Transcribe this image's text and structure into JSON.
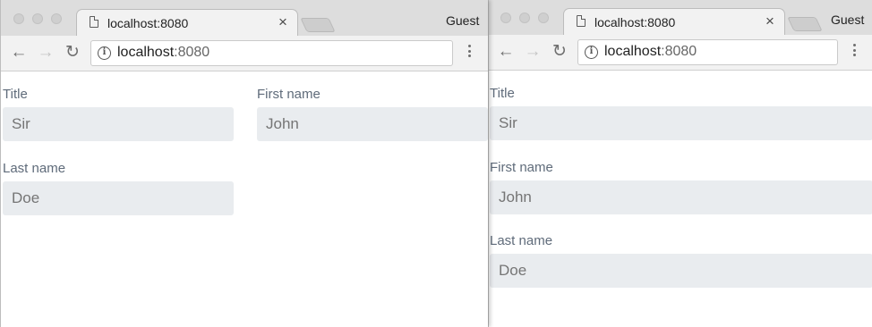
{
  "left_window": {
    "tab": {
      "title": "localhost:8080",
      "close": "×"
    },
    "profile": "Guest",
    "address": {
      "host": "localhost",
      "port": ":8080"
    },
    "form": {
      "title": {
        "label": "Title",
        "value": "Sir"
      },
      "first_name": {
        "label": "First name",
        "value": "John"
      },
      "last_name": {
        "label": "Last name",
        "value": "Doe"
      }
    }
  },
  "right_window": {
    "tab": {
      "title": "localhost:8080",
      "close": "×"
    },
    "profile": "Guest",
    "address": {
      "host": "localhost",
      "port": ":8080"
    },
    "form": {
      "title": {
        "label": "Title",
        "value": "Sir"
      },
      "first_name": {
        "label": "First name",
        "value": "John"
      },
      "last_name": {
        "label": "Last name",
        "value": "Doe"
      }
    }
  },
  "icons": {
    "back": "←",
    "forward": "→",
    "reload": "↻",
    "info": "i",
    "file": "file-icon",
    "menu": "more-vert-icon"
  },
  "colors": {
    "tabstrip": "#dddddd",
    "toolbar": "#f2f2f2",
    "input_bg": "#e9ecef",
    "label_text": "#5f6b7a",
    "input_text": "#8e959c"
  }
}
